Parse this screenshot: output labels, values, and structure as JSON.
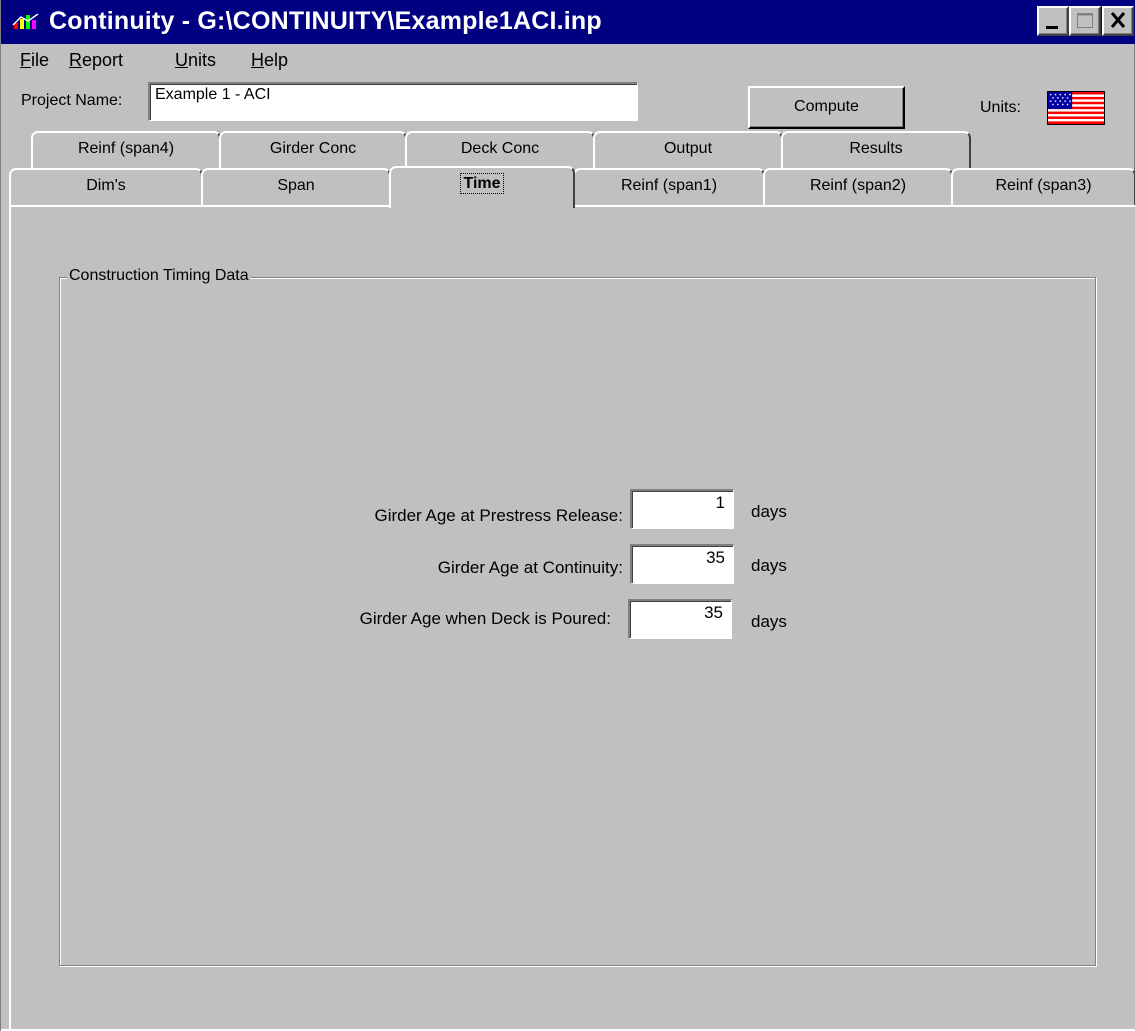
{
  "window": {
    "title": "Continuity - G:\\CONTINUITY\\Example1ACI.inp"
  },
  "menu": {
    "file": {
      "accel": "F",
      "rest": "ile"
    },
    "report": {
      "accel": "R",
      "rest": "eport"
    },
    "units": {
      "accel": "U",
      "rest": "nits"
    },
    "help": {
      "accel": "H",
      "rest": "elp"
    }
  },
  "project": {
    "name_label": "Project Name:",
    "name_value": "Example 1 - ACI",
    "compute_label": "Compute",
    "units_label": "Units:",
    "units_flag": "us-flag-icon"
  },
  "tabs": {
    "back_row": [
      "Reinf (span4)",
      "Girder Conc",
      "Deck Conc",
      "Output",
      "Results"
    ],
    "front_row": [
      "Dim's",
      "Span",
      "Time",
      "Reinf (span1)",
      "Reinf (span2)",
      "Reinf (span3)"
    ],
    "active": "Time"
  },
  "timing": {
    "group_title": "Construction Timing Data",
    "rows": [
      {
        "label": "Girder Age at Prestress Release:",
        "value": "1",
        "unit": "days"
      },
      {
        "label": "Girder Age at Continuity:",
        "value": "35",
        "unit": "days"
      },
      {
        "label": "Girder Age when Deck is Poured:",
        "value": "35",
        "unit": "days"
      }
    ]
  },
  "colors": {
    "titlebar": "#000080",
    "face": "#c0c0c0"
  }
}
